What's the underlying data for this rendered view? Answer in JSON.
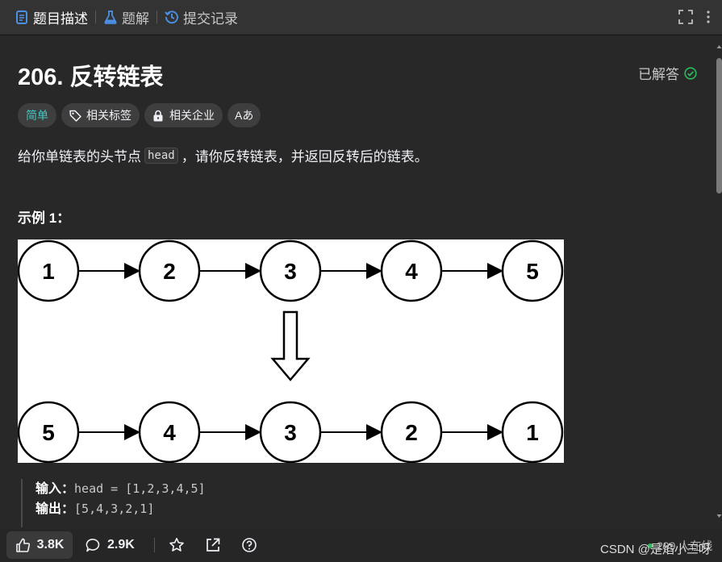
{
  "tabs": [
    {
      "label": "题目描述",
      "active": true
    },
    {
      "label": "题解",
      "active": false
    },
    {
      "label": "提交记录",
      "active": false
    }
  ],
  "problem": {
    "title": "206. 反转链表",
    "status": "已解答",
    "tags": {
      "difficulty": "简单",
      "topics": "相关标签",
      "companies": "相关企业",
      "translate": "Aあ"
    },
    "description": {
      "before": "给你单链表的头节点",
      "code": "head",
      "after": "，请你反转链表，并返回反转后的链表。"
    },
    "example_title": "示例 1：",
    "example": {
      "input_label": "输入：",
      "input_value": "head = [1,2,3,4,5]",
      "output_label": "输出：",
      "output_value": "[5,4,3,2,1]"
    },
    "diagram": {
      "top_nodes": [
        "1",
        "2",
        "3",
        "4",
        "5"
      ],
      "bottom_nodes": [
        "5",
        "4",
        "3",
        "2",
        "1"
      ]
    }
  },
  "footer": {
    "likes": "3.8K",
    "comments": "2.9K",
    "online": "299 人在线"
  },
  "watermark": "CSDN @是焰小三呀",
  "colors": {
    "accent_blue": "#4a90e2",
    "easy_teal": "#46c6c2",
    "solved_green": "#2cbb5d",
    "panel_bg": "#282828",
    "tabbar_bg": "#333333"
  }
}
